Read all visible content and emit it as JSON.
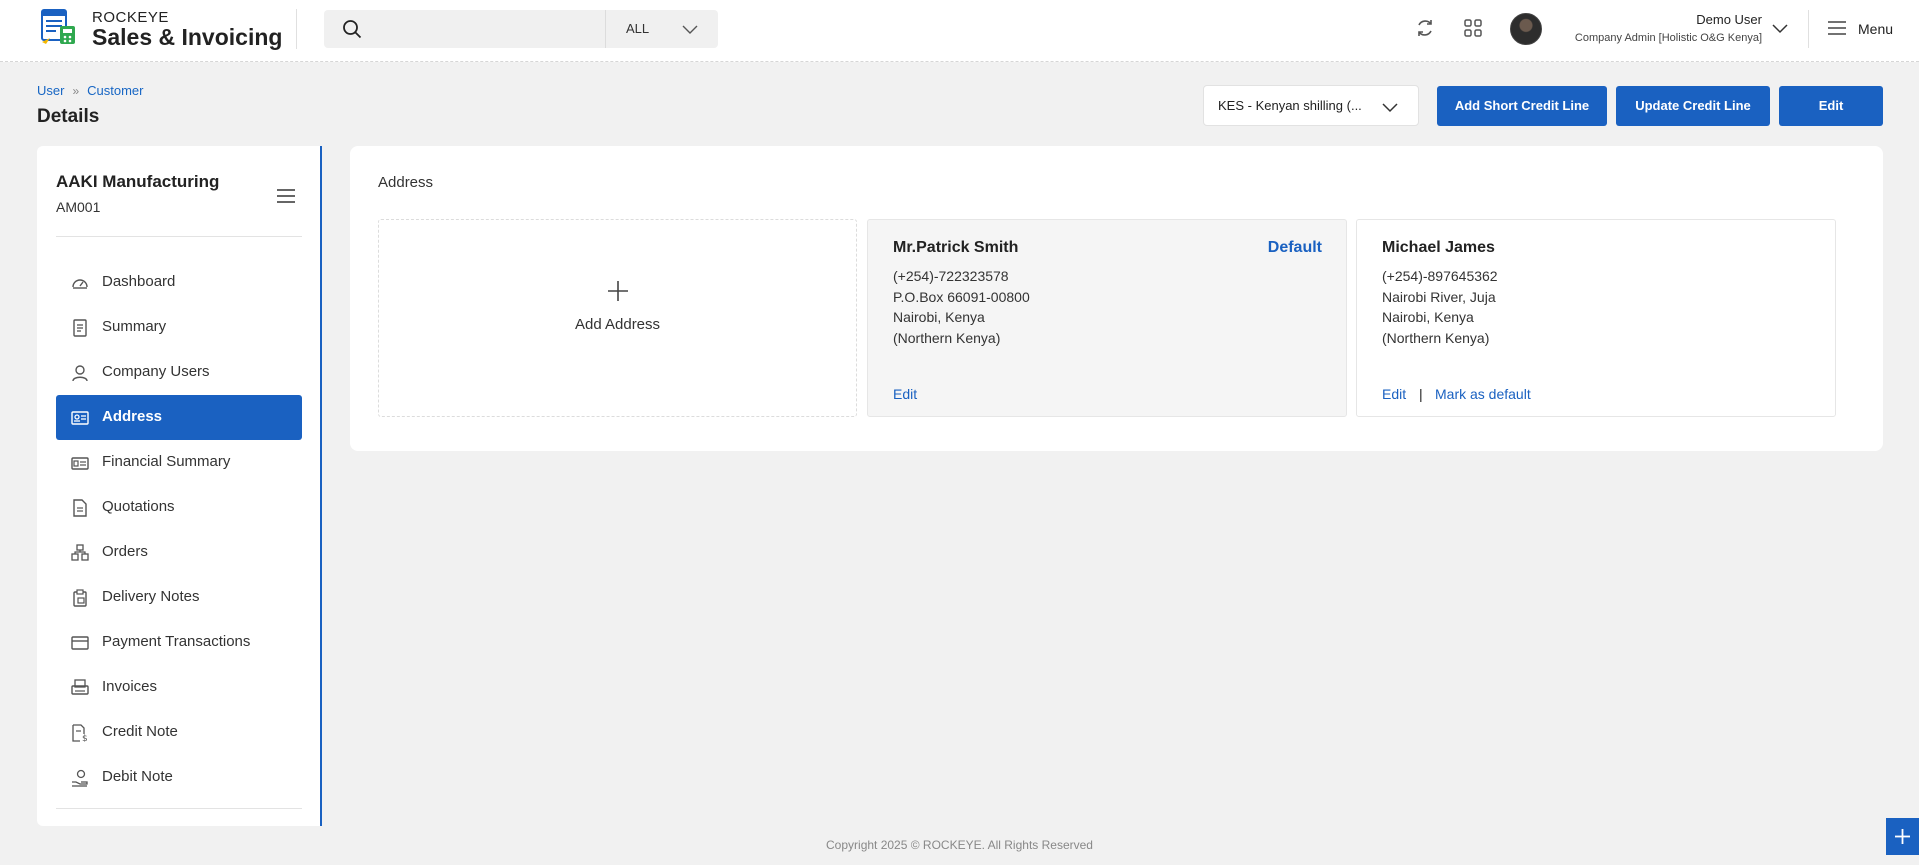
{
  "header": {
    "brand_top": "ROCKEYE",
    "brand_main": "Sales & Invoicing",
    "search_placeholder": "",
    "search_scope": "ALL",
    "user_name": "Demo User",
    "user_role": "Company Admin [Holistic O&G Kenya]",
    "menu_label": "Menu"
  },
  "breadcrumb": {
    "items": [
      "User",
      "Customer"
    ]
  },
  "page_title": "Details",
  "currency": {
    "selected": "KES - Kenyan shilling (..."
  },
  "actions": {
    "add_short_credit": "Add Short Credit Line",
    "update_credit": "Update Credit Line",
    "edit": "Edit"
  },
  "customer": {
    "name": "AAKI Manufacturing",
    "code": "AM001"
  },
  "sidebar": {
    "items": [
      {
        "label": "Dashboard",
        "icon": "dashboard-icon"
      },
      {
        "label": "Summary",
        "icon": "summary-icon"
      },
      {
        "label": "Company Users",
        "icon": "user-icon"
      },
      {
        "label": "Address",
        "icon": "address-card-icon",
        "active": true
      },
      {
        "label": "Financial Summary",
        "icon": "financial-icon"
      },
      {
        "label": "Quotations",
        "icon": "quotation-icon"
      },
      {
        "label": "Orders",
        "icon": "orders-icon"
      },
      {
        "label": "Delivery Notes",
        "icon": "delivery-icon"
      },
      {
        "label": "Payment Transactions",
        "icon": "card-icon"
      },
      {
        "label": "Invoices",
        "icon": "invoice-icon"
      },
      {
        "label": "Credit Note",
        "icon": "credit-note-icon"
      },
      {
        "label": "Debit Note",
        "icon": "debit-note-icon"
      }
    ]
  },
  "address": {
    "section_title": "Address",
    "add_label": "Add Address",
    "cards": [
      {
        "name": "Mr.Patrick Smith",
        "badge": "Default",
        "lines": [
          "(+254)-722323578",
          "P.O.Box 66091-00800",
          "Nairobi, Kenya",
          "(Northern Kenya)"
        ],
        "edit": "Edit"
      },
      {
        "name": "Michael James",
        "lines": [
          "(+254)-897645362",
          "Nairobi River, Juja",
          "Nairobi, Kenya",
          "(Northern Kenya)"
        ],
        "edit": "Edit",
        "separator": "|",
        "mark_default": "Mark as default"
      }
    ]
  },
  "footer": "Copyright 2025 © ROCKEYE. All Rights Reserved",
  "colors": {
    "primary": "#1a61c1",
    "background": "#f1f1f1"
  }
}
